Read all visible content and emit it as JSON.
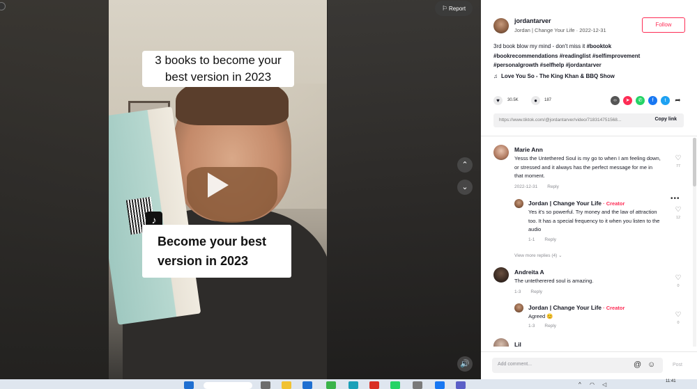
{
  "video": {
    "caption_top": "3 books to become your best version in 2023",
    "caption_bottom": "Become your best version in 2023",
    "report_label": "Report"
  },
  "post": {
    "username": "jordantarver",
    "subtitle": "Jordan | Change Your Life · 2022-12-31",
    "follow_label": "Follow",
    "description": "3rd book blow my mind - don't miss it ",
    "hashtags_line1": "#booktok",
    "hashtags_line2": "#bookrecommendations #readinglist #selfimprovement",
    "hashtags_line3": "#personalgrowth #selfhelp #jordantarver",
    "music": "Love You So - The King Khan & BBQ Show",
    "likes": "30.5K",
    "comments_count": "187",
    "link_url": "https://www.tiktok.com/@jordantarver/video/718314751568...",
    "copy_link_label": "Copy link"
  },
  "comments": [
    {
      "name": "Marie Ann",
      "text": "Yesss the Untethered Soul is my go to when I am feeling down, or stressed and it always has the perfect message for me in that moment.",
      "date": "2022-12-31",
      "reply_label": "Reply",
      "likes": "77"
    },
    {
      "name": "Jordan | Change Your Life",
      "creator": " · Creator",
      "text": "Yes it's so powerful. Try money and the law of attraction too. It has a special frequency to it when you listen to the audio",
      "date": "1-1",
      "reply_label": "Reply",
      "likes": "12"
    },
    {
      "view_more": "View more replies (4)"
    },
    {
      "name": "Andreita A",
      "text": "The untetherered soul is amazing.",
      "date": "1-3",
      "reply_label": "Reply",
      "likes": "0"
    },
    {
      "name": "Jordan | Change Your Life",
      "creator": " · Creator",
      "text": "Agreed 😊",
      "date": "1-3",
      "reply_label": "Reply",
      "likes": "0"
    },
    {
      "name": "Lil"
    }
  ],
  "composer": {
    "placeholder": "Add comment...",
    "post_label": "Post"
  },
  "taskbar": {
    "clock": "11:41"
  }
}
